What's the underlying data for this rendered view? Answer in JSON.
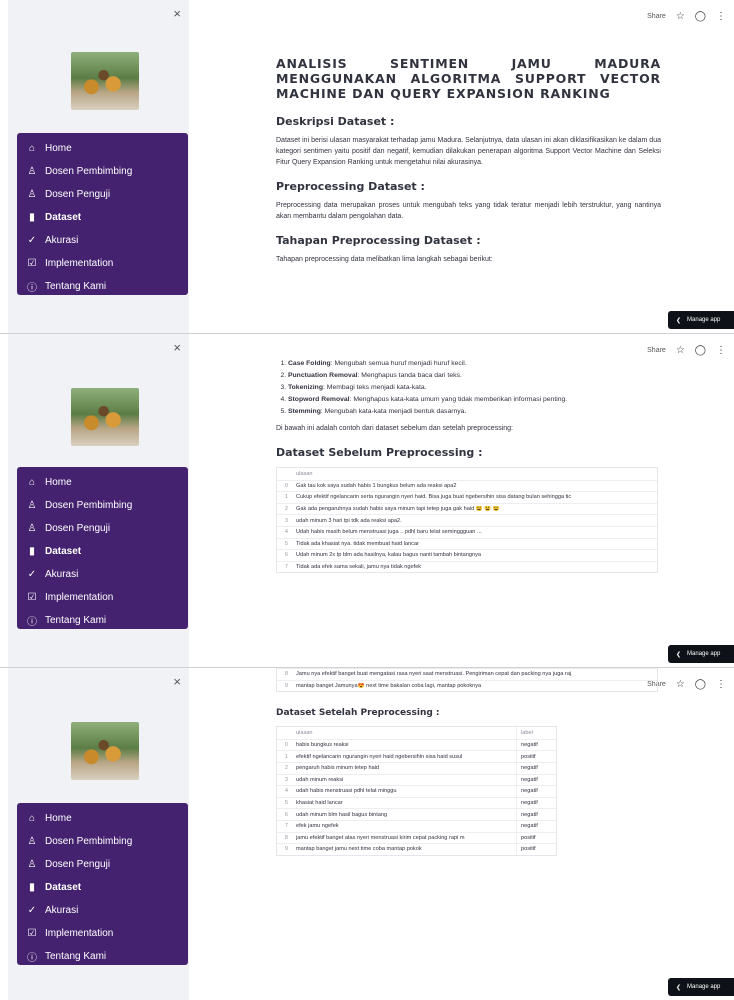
{
  "topbar": {
    "share": "Share",
    "star_icon": "star-icon",
    "github_icon": "github-icon",
    "menu_icon": "kebab-menu-icon"
  },
  "manage_app": {
    "label": "Manage app"
  },
  "sidebar": {
    "close": "×",
    "items": [
      {
        "label": "Home",
        "icon": "home-icon",
        "glyph": "⌂"
      },
      {
        "label": "Dosen Pembimbing",
        "icon": "person-icon",
        "glyph": "♙"
      },
      {
        "label": "Dosen Penguji",
        "icon": "person-icon",
        "glyph": "♙"
      },
      {
        "label": "Dataset",
        "icon": "bar-chart-icon",
        "glyph": "▮"
      },
      {
        "label": "Akurasi",
        "icon": "check-circle-icon",
        "glyph": "✓"
      },
      {
        "label": "Implementation",
        "icon": "check-square-icon",
        "glyph": "☑"
      },
      {
        "label": "Tentang Kami",
        "icon": "info-icon",
        "glyph": "ⓘ"
      }
    ],
    "active_index": 3
  },
  "page": {
    "title": "ANALISIS SENTIMEN JAMU MADURA MENGGUNAKAN ALGORITMA SUPPORT VECTOR MACHINE DAN QUERY EXPANSION RANKING",
    "desc_heading": "Deskripsi Dataset :",
    "desc_text": "Dataset ini berisi ulasan masyarakat terhadap jamu Madura. Selanjutnya, data ulasan ini akan diklasifikasikan ke dalam dua kategori sentimen yaitu positif dan negatif, kemudian dilakukan penerapan algoritma Support Vector Machine dan Seleksi Fitur Query Expansion Ranking untuk mengetahui nilai akurasinya.",
    "prep_heading": "Preprocessing Dataset :",
    "prep_text": "Preprocessing data merupakan proses untuk mengubah teks yang tidak teratur menjadi lebih terstruktur, yang nantinya akan membantu dalam pengolahan data.",
    "steps_heading": "Tahapan Preprocessing Dataset :",
    "steps_intro": "Tahapan preprocessing data melibatkan lima langkah sebagai berikut:",
    "steps": [
      {
        "term": "Case Folding",
        "desc": ": Mengubah semua huruf menjadi huruf kecil."
      },
      {
        "term": "Punctuation Removal",
        "desc": ": Menghapus tanda baca dari teks."
      },
      {
        "term": "Tokenizing",
        "desc": ": Membagi teks menjadi kata-kata."
      },
      {
        "term": "Stopword Removal",
        "desc": ": Menghapus kata-kata umum yang tidak memberikan informasi penting."
      },
      {
        "term": "Stemming",
        "desc": ": Mengubah kata-kata menjadi bentuk dasarnya."
      }
    ],
    "example_intro": "Di bawah ini adalah contoh dari dataset sebelum dan setelah preprocessing:",
    "before_heading": "Dataset Sebelum Preprocessing :",
    "after_heading": "Dataset Setelah Preprocessing :"
  },
  "before_table": {
    "column": "ulasan",
    "rows": [
      {
        "idx": "0",
        "ulasan": "Gak tau kok saya sudah habis 1 bungkus belum ada reaksi apa2"
      },
      {
        "idx": "1",
        "ulasan": "Cukup efektif ngelancarin serta ngurangin nyeri haid. Bisa juga buat ngebersihin sisa datang bulan sehingga tic"
      },
      {
        "idx": "2",
        "ulasan": "Gak ada pengaruhnya sudah habis saya minum tapi tetep juga gak haid 😫 😫 😫"
      },
      {
        "idx": "3",
        "ulasan": "udah minum 3 hari tpi tdk ada reaksi apa2."
      },
      {
        "idx": "4",
        "ulasan": "Udah habis masih belum menstruasi juga .. pdhl baru telat seminggguan ..."
      },
      {
        "idx": "5",
        "ulasan": "Tidak ada khasiat nya. tidak membuat haid lancar"
      },
      {
        "idx": "6",
        "ulasan": "Udah minum 2x tp blm ada hasilnya, kalau bagus nanti tambah bintangnya"
      },
      {
        "idx": "7",
        "ulasan": "Tidak ada efek sama sekali, jamu nya tidak ngefek"
      },
      {
        "idx": "8",
        "ulasan": "Jamu nya efektif banget buat mengatasi rasa nyeri saat menstruasi. Pengiriman cepat dan packing nya juga raj"
      },
      {
        "idx": "9",
        "ulasan": "mantap banget Jamunya😍 next time bakalan coba lagi, mantap pokoknya"
      }
    ]
  },
  "after_table": {
    "columns": [
      "ulasan",
      "label"
    ],
    "rows": [
      {
        "idx": "0",
        "ulasan": "habis bungkus reaksi",
        "label": "negatif"
      },
      {
        "idx": "1",
        "ulasan": "efektif ngelancarin ngurangin nyeri haid ngebersihin sisa haid susul",
        "label": "positif"
      },
      {
        "idx": "2",
        "ulasan": "pengaruh habis minum tetep haid",
        "label": "negatif"
      },
      {
        "idx": "3",
        "ulasan": "udah minum reaksi",
        "label": "negatif"
      },
      {
        "idx": "4",
        "ulasan": "udah habis menstruasi pdhl telat minggu",
        "label": "negatif"
      },
      {
        "idx": "5",
        "ulasan": "khasiat haid lancar",
        "label": "negatif"
      },
      {
        "idx": "6",
        "ulasan": "udah minum blm hasil bagus bintang",
        "label": "negatif"
      },
      {
        "idx": "7",
        "ulasan": "efek jamu ngefek",
        "label": "negatif"
      },
      {
        "idx": "8",
        "ulasan": "jamu efektif banget atas nyeri menstruasi kirim cepat packing rapi m",
        "label": "positif"
      },
      {
        "idx": "9",
        "ulasan": "mantap banget jamu next time coba mantap pokok",
        "label": "positif"
      }
    ]
  }
}
